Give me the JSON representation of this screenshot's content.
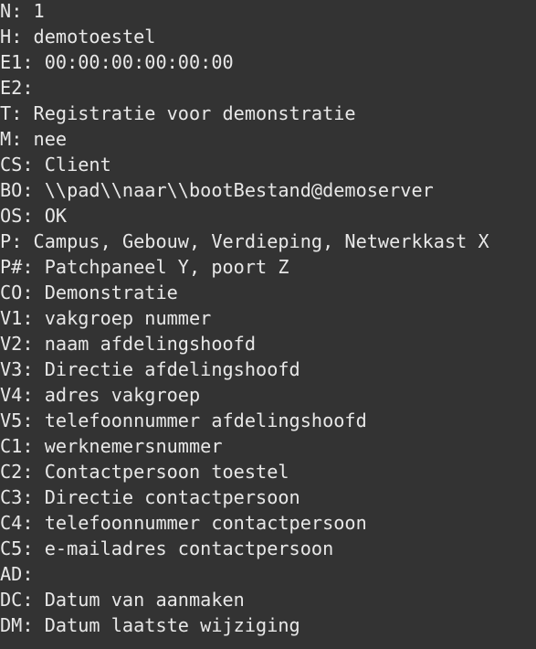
{
  "terminal": {
    "background": "#333333",
    "foreground": "#e8e8e8",
    "lines": [
      {
        "key": "N",
        "value": "1"
      },
      {
        "key": "H",
        "value": "demotoestel"
      },
      {
        "key": "E1",
        "value": "00:00:00:00:00:00"
      },
      {
        "key": "E2",
        "value": ""
      },
      {
        "key": "T",
        "value": "Registratie voor demonstratie"
      },
      {
        "key": "M",
        "value": "nee"
      },
      {
        "key": "CS",
        "value": "Client"
      },
      {
        "key": "BO",
        "value": "\\\\pad\\\\naar\\\\bootBestand@demoserver"
      },
      {
        "key": "OS",
        "value": "OK"
      },
      {
        "key": "P",
        "value": "Campus, Gebouw, Verdieping, Netwerkkast X"
      },
      {
        "key": "P#",
        "value": "Patchpaneel Y, poort Z"
      },
      {
        "key": "CO",
        "value": "Demonstratie"
      },
      {
        "key": "V1",
        "value": "vakgroep nummer"
      },
      {
        "key": "V2",
        "value": "naam afdelingshoofd"
      },
      {
        "key": "V3",
        "value": "Directie afdelingshoofd"
      },
      {
        "key": "V4",
        "value": "adres vakgroep"
      },
      {
        "key": "V5",
        "value": "telefoonnummer afdelingshoofd"
      },
      {
        "key": "C1",
        "value": "werknemersnummer"
      },
      {
        "key": "C2",
        "value": "Contactpersoon toestel"
      },
      {
        "key": "C3",
        "value": "Directie contactpersoon"
      },
      {
        "key": "C4",
        "value": "telefoonnummer contactpersoon"
      },
      {
        "key": "C5",
        "value": "e-mailadres contactpersoon"
      },
      {
        "key": "AD",
        "value": ""
      },
      {
        "key": "DC",
        "value": "Datum van aanmaken"
      },
      {
        "key": "DM",
        "value": "Datum laatste wijziging"
      }
    ]
  }
}
